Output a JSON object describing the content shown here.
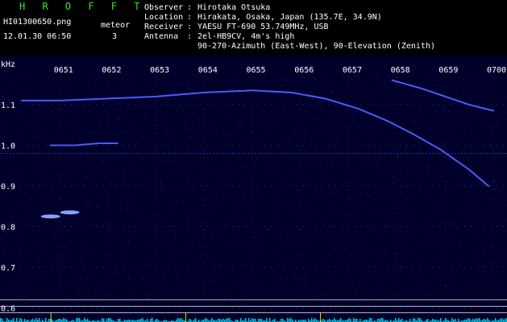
{
  "header": {
    "logo": "H R O F F T",
    "filename": "HI01300650.png",
    "datetime": "12.01.30 06:50",
    "meteor_label": "meteor",
    "meteor_count": "3",
    "fields": [
      {
        "label": "Observer",
        "value": "Hirotaka Otsuka"
      },
      {
        "label": "Location",
        "value": "Hirakata, Osaka, Japan (135.7E, 34.9N)"
      },
      {
        "label": "Receiver",
        "value": "YAESU FT-690 53.749MHz, USB"
      },
      {
        "label": "Antenna",
        "value": "2el-HB9CV, 4m's high"
      },
      {
        "label": "",
        "value": "90-270-Azimuth (East-West), 90-Elevation (Zenith)"
      }
    ]
  },
  "colors": {
    "background": "#00002a",
    "header_bg": "#000000",
    "logo": "#2ee62e",
    "signal": "#4a5cff",
    "noise_bars": "#00c8e6",
    "baseline_lines": "#b4b4b4",
    "marker": "#e6e600"
  },
  "chart_data": {
    "type": "spectrogram",
    "y_unit": "kHz",
    "x_ticks": [
      "0651",
      "0652",
      "0653",
      "0654",
      "0655",
      "0656",
      "0657",
      "0658",
      "0659",
      "0700"
    ],
    "y_ticks": [
      1.1,
      1.0,
      0.9,
      0.8,
      0.7,
      0.6
    ],
    "xlim": [
      "06:50",
      "07:00"
    ],
    "ylim": [
      0.58,
      1.17
    ],
    "grid": true,
    "traces": [
      {
        "points": [
          [
            50.2,
            1.11
          ],
          [
            51.0,
            1.11
          ],
          [
            52.0,
            1.115
          ],
          [
            53.0,
            1.12
          ],
          [
            54.0,
            1.13
          ],
          [
            55.0,
            1.135
          ],
          [
            55.8,
            1.13
          ],
          [
            56.5,
            1.115
          ],
          [
            57.2,
            1.09
          ],
          [
            57.8,
            1.06
          ],
          [
            58.3,
            1.03
          ],
          [
            58.9,
            0.99
          ],
          [
            59.5,
            0.94
          ],
          [
            59.9,
            0.9
          ]
        ]
      },
      {
        "points": [
          [
            57.9,
            1.16
          ],
          [
            58.5,
            1.14
          ],
          [
            59.0,
            1.12
          ],
          [
            59.5,
            1.1
          ],
          [
            60.0,
            1.085
          ]
        ]
      },
      {
        "points": [
          [
            50.8,
            1.0
          ],
          [
            51.3,
            1.0
          ],
          [
            51.8,
            1.005
          ],
          [
            52.2,
            1.005
          ]
        ]
      }
    ],
    "meteor_echoes": [
      {
        "x": 50.8,
        "y": 0.825
      },
      {
        "x": 51.2,
        "y": 0.835
      }
    ],
    "noise_band_y": 0.98,
    "baseline_levels": [
      0.62,
      0.604,
      0.588
    ]
  }
}
